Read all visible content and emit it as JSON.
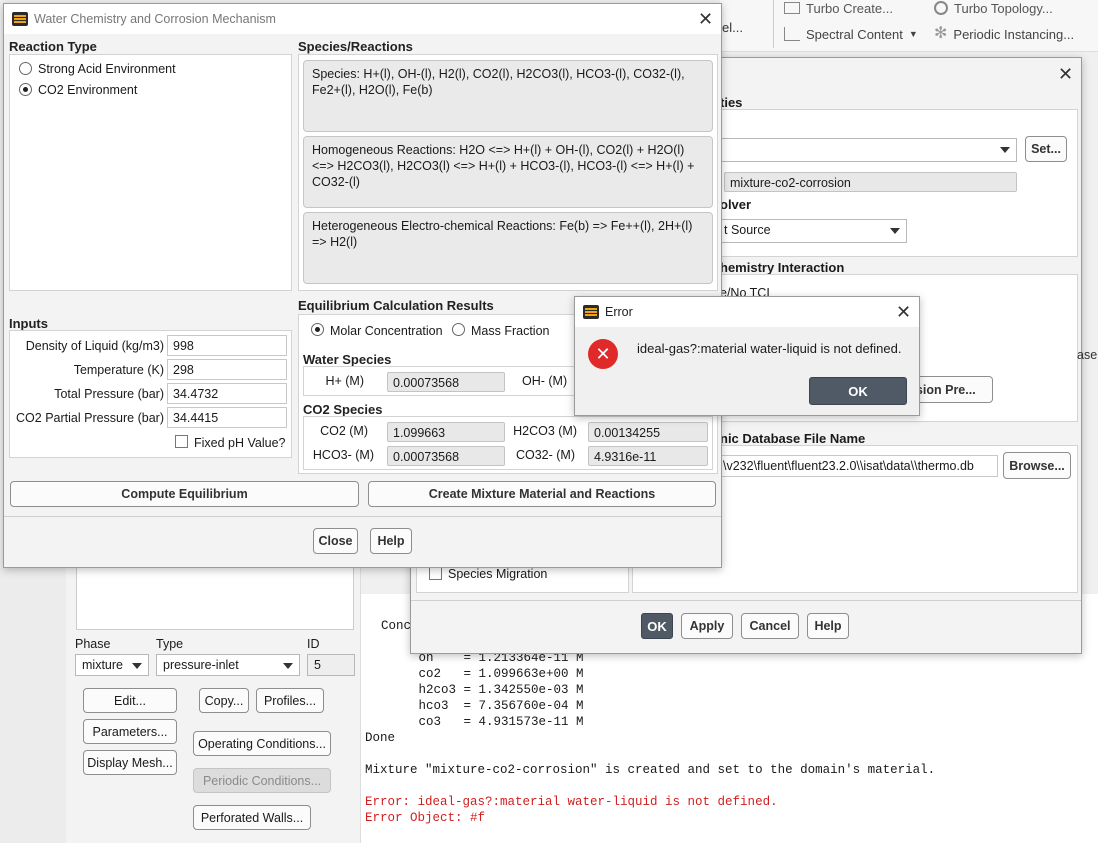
{
  "toolbar": {
    "turbo_create": "Turbo Create...",
    "turbo_topology": "Turbo Topology...",
    "spectral_content": "Spectral Content",
    "periodic_instancing": "Periodic Instancing...",
    "partial_label": "el..."
  },
  "dialog_main": {
    "title": "Water Chemistry and Corrosion Mechanism",
    "reaction_type_title": "Reaction Type",
    "reaction_types": [
      {
        "label": "Strong Acid Environment",
        "selected": false
      },
      {
        "label": "CO2 Environment",
        "selected": true
      }
    ],
    "species_reactions_title": "Species/Reactions",
    "species_text": "Species: H+(l), OH-(l), H2(l), CO2(l), H2CO3(l), HCO3-(l), CO32-(l), Fe2+(l), H2O(l), Fe(b)",
    "homogeneous_text": "Homogeneous Reactions: H2O <=> H+(l) + OH-(l), CO2(l) + H2O(l) <=> H2CO3(l), H2CO3(l) <=> H+(l) + HCO3-(l), HCO3-(l) <=> H+(l) + CO32-(l)",
    "heterogeneous_text": "Heterogeneous Electro-chemical Reactions: Fe(b) => Fe++(l), 2H+(l) => H2(l)",
    "inputs_title": "Inputs",
    "inputs": {
      "density_label": "Density of Liquid (kg/m3)",
      "density_value": "998",
      "temperature_label": "Temperature (K)",
      "temperature_value": "298",
      "total_pressure_label": "Total Pressure (bar)",
      "total_pressure_value": "34.4732",
      "co2_partial_label": "CO2 Partial Pressure (bar)",
      "co2_partial_value": "34.4415",
      "fixed_ph_label": "Fixed pH Value?"
    },
    "equilibrium_title": "Equilibrium Calculation Results",
    "molar_label": "Molar Concentration",
    "mass_fraction_label": "Mass Fraction",
    "water_species_title": "Water Species",
    "h_plus_label": "H+ (M)",
    "h_plus_value": "0.00073568",
    "oh_label": "OH- (M)",
    "co2_species_title": "CO2 Species",
    "co2_label": "CO2 (M)",
    "co2_value": "1.099663",
    "h2co3_label": "H2CO3 (M)",
    "h2co3_value": "0.00134255",
    "hco3_label": "HCO3- (M)",
    "hco3_value": "0.00073568",
    "co32_label": "CO32- (M)",
    "co32_value": "4.9316e-11",
    "compute_button": "Compute Equilibrium",
    "create_button": "Create Mixture Material and Reactions",
    "close_button": "Close",
    "help_button": "Help"
  },
  "dialog_back": {
    "ties_label": "ties",
    "set_button": "Set...",
    "mixture_name": "mixture-co2-corrosion",
    "olver_label": "olver",
    "source_value": "t Source",
    "chem_interaction_label": "hemistry Interaction",
    "tci_label": "e/No TCI",
    "corrosion_btn": "osion Pre...",
    "db_label": "nic Database File Name",
    "db_path": "\\v232\\fluent\\fluent23.2.0\\\\isat\\data\\\\thermo.db",
    "browse_button": "Browse...",
    "species_migration": "Species Migration",
    "ok_button": "OK",
    "apply_button": "Apply",
    "cancel_button": "Cancel",
    "help_button": "Help",
    "ase_partial": "ase"
  },
  "error_dialog": {
    "title": "Error",
    "message": "ideal-gas?:material water-liquid is not defined.",
    "ok_button": "OK"
  },
  "panel": {
    "phase_label": "Phase",
    "type_label": "Type",
    "id_label": "ID",
    "phase_value": "mixture",
    "type_value": "pressure-inlet",
    "id_value": "5",
    "edit_button": "Edit...",
    "copy_button": "Copy...",
    "profiles_button": "Profiles...",
    "parameters_button": "Parameters...",
    "operating_button": "Operating Conditions...",
    "display_mesh_button": "Display Mesh...",
    "periodic_button": "Periodic Conditions...",
    "perforated_button": "Perforated Walls..."
  },
  "console": {
    "cond_partial": "Conc",
    "lines": [
      "     oh    = 1.213364e-11 M",
      "     co2   = 1.099663e+00 M",
      "     h2co3 = 1.342550e-03 M",
      "     hco3  = 7.356760e-04 M",
      "     co3   = 4.931573e-11 M"
    ],
    "done": "Done",
    "mixture_msg": "Mixture \"mixture-co2-corrosion\" is created and set to the domain's material.",
    "error_line": "Error: ideal-gas?:material water-liquid is not defined.",
    "error_object": "Error Object: #f"
  },
  "colors": {
    "error_red": "#d21f1f",
    "ok_button_dark": "#505a66",
    "accent_orange": "#f0a21a"
  }
}
